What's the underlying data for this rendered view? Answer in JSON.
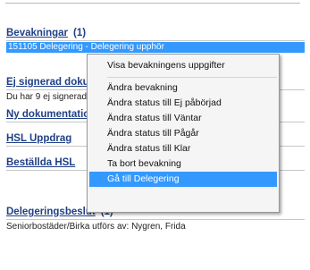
{
  "sections": {
    "bevakningar": {
      "title": "Bevakningar",
      "count": "(1)",
      "selected_row": "151105 Delegering - Delegering upphör"
    },
    "ej_signerad": {
      "title": "Ej signerad dokumentation",
      "text": "Du har 9 ej signerade dokumentationer"
    },
    "ny_dokumentation": {
      "title": "Ny dokumentation"
    },
    "hsl_uppdrag": {
      "title": "HSL Uppdrag"
    },
    "bestallda_hsl": {
      "title": "Beställda HSL"
    },
    "delegeringsbeslut": {
      "title": "Delegeringsbeslut",
      "count": "(1)",
      "text": "Seniorbostäder/Birka utförs av: Nygren, Frida"
    }
  },
  "context_menu": {
    "items": [
      "Visa bevakningens uppgifter",
      "Ändra bevakning",
      "Ändra status till Ej påbörjad",
      "Ändra status till Väntar",
      "Ändra status till Pågår",
      "Ändra status till Klar",
      "Ta bort bevakning",
      "Gå till Delegering"
    ],
    "highlighted_item": "Gå till Delegering"
  }
}
